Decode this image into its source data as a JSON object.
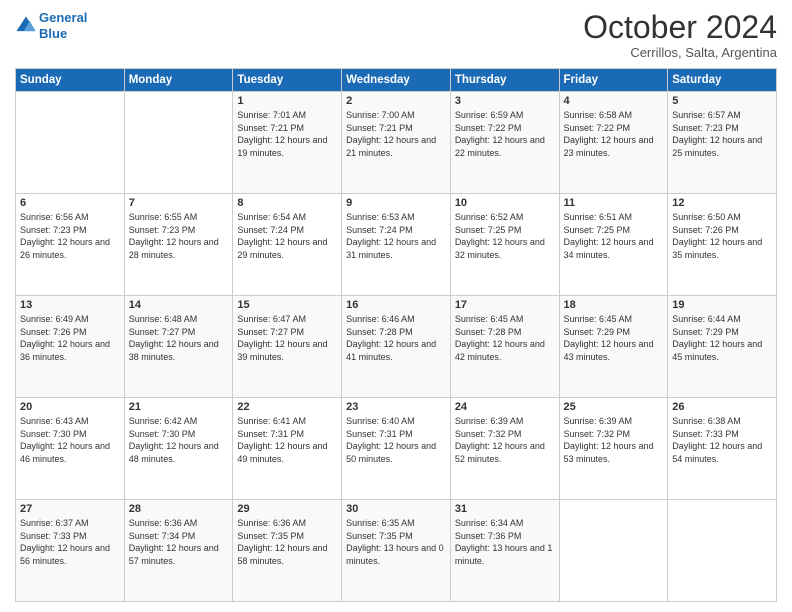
{
  "logo": {
    "line1": "General",
    "line2": "Blue"
  },
  "title": "October 2024",
  "subtitle": "Cerrillos, Salta, Argentina",
  "weekdays": [
    "Sunday",
    "Monday",
    "Tuesday",
    "Wednesday",
    "Thursday",
    "Friday",
    "Saturday"
  ],
  "weeks": [
    [
      {
        "day": "",
        "sunrise": "",
        "sunset": "",
        "daylight": ""
      },
      {
        "day": "",
        "sunrise": "",
        "sunset": "",
        "daylight": ""
      },
      {
        "day": "1",
        "sunrise": "Sunrise: 7:01 AM",
        "sunset": "Sunset: 7:21 PM",
        "daylight": "Daylight: 12 hours and 19 minutes."
      },
      {
        "day": "2",
        "sunrise": "Sunrise: 7:00 AM",
        "sunset": "Sunset: 7:21 PM",
        "daylight": "Daylight: 12 hours and 21 minutes."
      },
      {
        "day": "3",
        "sunrise": "Sunrise: 6:59 AM",
        "sunset": "Sunset: 7:22 PM",
        "daylight": "Daylight: 12 hours and 22 minutes."
      },
      {
        "day": "4",
        "sunrise": "Sunrise: 6:58 AM",
        "sunset": "Sunset: 7:22 PM",
        "daylight": "Daylight: 12 hours and 23 minutes."
      },
      {
        "day": "5",
        "sunrise": "Sunrise: 6:57 AM",
        "sunset": "Sunset: 7:23 PM",
        "daylight": "Daylight: 12 hours and 25 minutes."
      }
    ],
    [
      {
        "day": "6",
        "sunrise": "Sunrise: 6:56 AM",
        "sunset": "Sunset: 7:23 PM",
        "daylight": "Daylight: 12 hours and 26 minutes."
      },
      {
        "day": "7",
        "sunrise": "Sunrise: 6:55 AM",
        "sunset": "Sunset: 7:23 PM",
        "daylight": "Daylight: 12 hours and 28 minutes."
      },
      {
        "day": "8",
        "sunrise": "Sunrise: 6:54 AM",
        "sunset": "Sunset: 7:24 PM",
        "daylight": "Daylight: 12 hours and 29 minutes."
      },
      {
        "day": "9",
        "sunrise": "Sunrise: 6:53 AM",
        "sunset": "Sunset: 7:24 PM",
        "daylight": "Daylight: 12 hours and 31 minutes."
      },
      {
        "day": "10",
        "sunrise": "Sunrise: 6:52 AM",
        "sunset": "Sunset: 7:25 PM",
        "daylight": "Daylight: 12 hours and 32 minutes."
      },
      {
        "day": "11",
        "sunrise": "Sunrise: 6:51 AM",
        "sunset": "Sunset: 7:25 PM",
        "daylight": "Daylight: 12 hours and 34 minutes."
      },
      {
        "day": "12",
        "sunrise": "Sunrise: 6:50 AM",
        "sunset": "Sunset: 7:26 PM",
        "daylight": "Daylight: 12 hours and 35 minutes."
      }
    ],
    [
      {
        "day": "13",
        "sunrise": "Sunrise: 6:49 AM",
        "sunset": "Sunset: 7:26 PM",
        "daylight": "Daylight: 12 hours and 36 minutes."
      },
      {
        "day": "14",
        "sunrise": "Sunrise: 6:48 AM",
        "sunset": "Sunset: 7:27 PM",
        "daylight": "Daylight: 12 hours and 38 minutes."
      },
      {
        "day": "15",
        "sunrise": "Sunrise: 6:47 AM",
        "sunset": "Sunset: 7:27 PM",
        "daylight": "Daylight: 12 hours and 39 minutes."
      },
      {
        "day": "16",
        "sunrise": "Sunrise: 6:46 AM",
        "sunset": "Sunset: 7:28 PM",
        "daylight": "Daylight: 12 hours and 41 minutes."
      },
      {
        "day": "17",
        "sunrise": "Sunrise: 6:45 AM",
        "sunset": "Sunset: 7:28 PM",
        "daylight": "Daylight: 12 hours and 42 minutes."
      },
      {
        "day": "18",
        "sunrise": "Sunrise: 6:45 AM",
        "sunset": "Sunset: 7:29 PM",
        "daylight": "Daylight: 12 hours and 43 minutes."
      },
      {
        "day": "19",
        "sunrise": "Sunrise: 6:44 AM",
        "sunset": "Sunset: 7:29 PM",
        "daylight": "Daylight: 12 hours and 45 minutes."
      }
    ],
    [
      {
        "day": "20",
        "sunrise": "Sunrise: 6:43 AM",
        "sunset": "Sunset: 7:30 PM",
        "daylight": "Daylight: 12 hours and 46 minutes."
      },
      {
        "day": "21",
        "sunrise": "Sunrise: 6:42 AM",
        "sunset": "Sunset: 7:30 PM",
        "daylight": "Daylight: 12 hours and 48 minutes."
      },
      {
        "day": "22",
        "sunrise": "Sunrise: 6:41 AM",
        "sunset": "Sunset: 7:31 PM",
        "daylight": "Daylight: 12 hours and 49 minutes."
      },
      {
        "day": "23",
        "sunrise": "Sunrise: 6:40 AM",
        "sunset": "Sunset: 7:31 PM",
        "daylight": "Daylight: 12 hours and 50 minutes."
      },
      {
        "day": "24",
        "sunrise": "Sunrise: 6:39 AM",
        "sunset": "Sunset: 7:32 PM",
        "daylight": "Daylight: 12 hours and 52 minutes."
      },
      {
        "day": "25",
        "sunrise": "Sunrise: 6:39 AM",
        "sunset": "Sunset: 7:32 PM",
        "daylight": "Daylight: 12 hours and 53 minutes."
      },
      {
        "day": "26",
        "sunrise": "Sunrise: 6:38 AM",
        "sunset": "Sunset: 7:33 PM",
        "daylight": "Daylight: 12 hours and 54 minutes."
      }
    ],
    [
      {
        "day": "27",
        "sunrise": "Sunrise: 6:37 AM",
        "sunset": "Sunset: 7:33 PM",
        "daylight": "Daylight: 12 hours and 56 minutes."
      },
      {
        "day": "28",
        "sunrise": "Sunrise: 6:36 AM",
        "sunset": "Sunset: 7:34 PM",
        "daylight": "Daylight: 12 hours and 57 minutes."
      },
      {
        "day": "29",
        "sunrise": "Sunrise: 6:36 AM",
        "sunset": "Sunset: 7:35 PM",
        "daylight": "Daylight: 12 hours and 58 minutes."
      },
      {
        "day": "30",
        "sunrise": "Sunrise: 6:35 AM",
        "sunset": "Sunset: 7:35 PM",
        "daylight": "Daylight: 13 hours and 0 minutes."
      },
      {
        "day": "31",
        "sunrise": "Sunrise: 6:34 AM",
        "sunset": "Sunset: 7:36 PM",
        "daylight": "Daylight: 13 hours and 1 minute."
      },
      {
        "day": "",
        "sunrise": "",
        "sunset": "",
        "daylight": ""
      },
      {
        "day": "",
        "sunrise": "",
        "sunset": "",
        "daylight": ""
      }
    ]
  ]
}
